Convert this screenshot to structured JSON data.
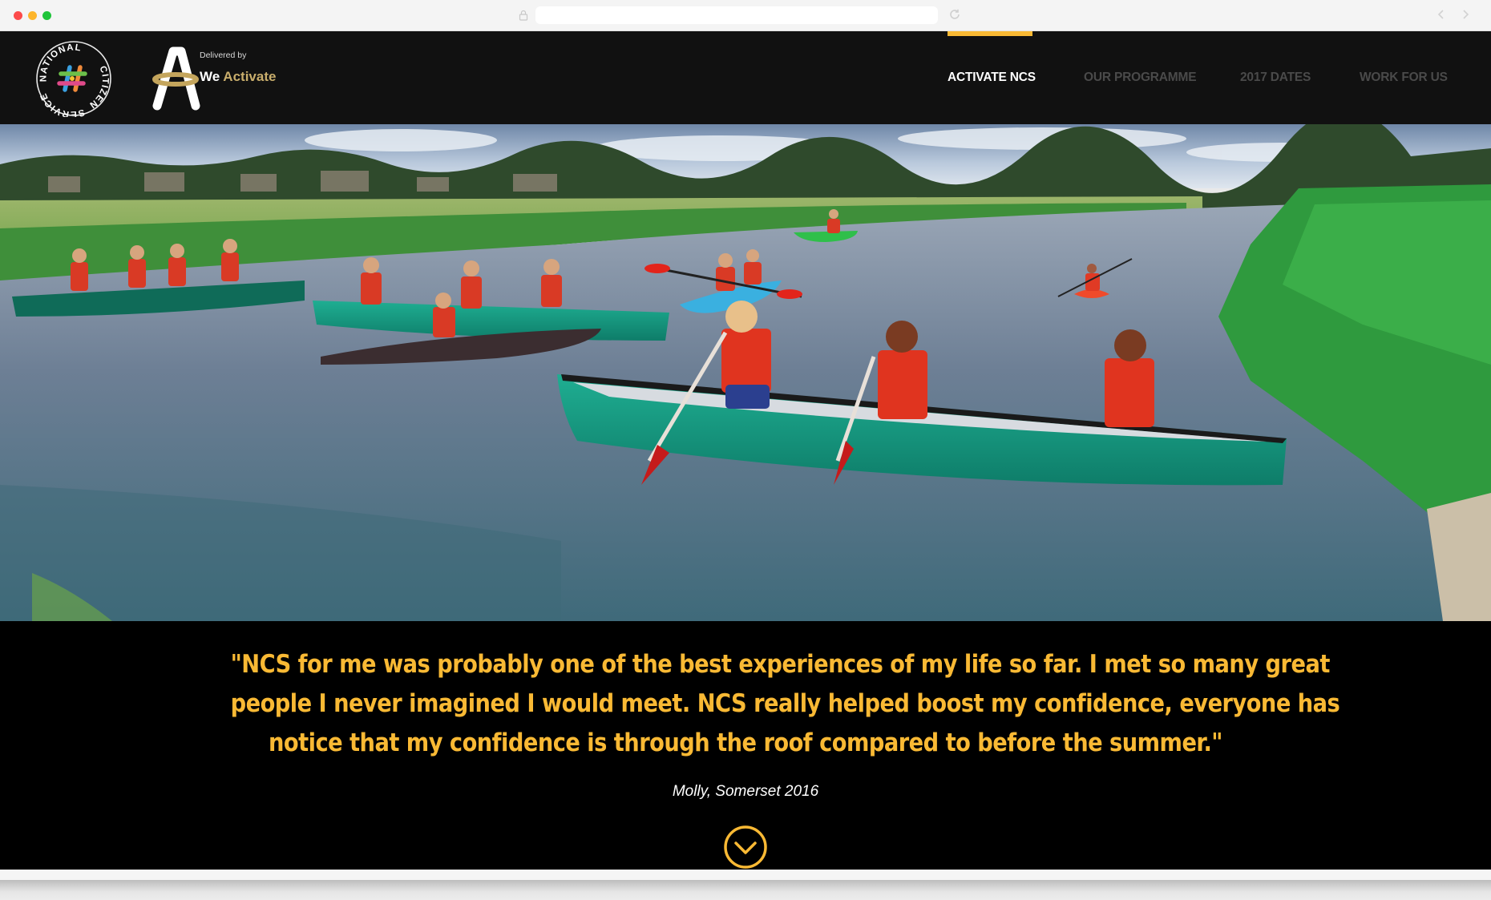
{
  "browser": {
    "url": "",
    "icons": [
      "lock-icon",
      "reload-icon",
      "back-arrow-icon",
      "forward-arrow-icon"
    ]
  },
  "header": {
    "ncs_logo": {
      "top_text": "NATIONAL",
      "right_text": "CITIZEN",
      "bottom_text": "SERVICE"
    },
    "delivered_by": "Delivered by",
    "brand_we": "We",
    "brand_activate": "Activate"
  },
  "nav": {
    "items": [
      {
        "label": "ACTIVATE NCS",
        "active": true
      },
      {
        "label": "OUR PROGRAMME",
        "active": false
      },
      {
        "label": "2017 DATES",
        "active": false
      },
      {
        "label": "WORK FOR US",
        "active": false
      }
    ]
  },
  "hero": {
    "description": "Young people canoeing and kayaking on a river"
  },
  "testimonial": {
    "lines": [
      "\"NCS for me was probably one of the best experiences of my life so far. I met so many great",
      "people I never imagined I would meet. NCS really helped boost my confidence, everyone has",
      "notice that my confidence is through the roof compared to before the summer.\""
    ],
    "attribution": "Molly, Somerset 2016"
  },
  "colors": {
    "accent": "#f9b934",
    "header_bg": "#111111",
    "quote_bg": "#000000",
    "brand_gold": "#c9ae6c",
    "nav_inactive": "#4a4a4a"
  }
}
